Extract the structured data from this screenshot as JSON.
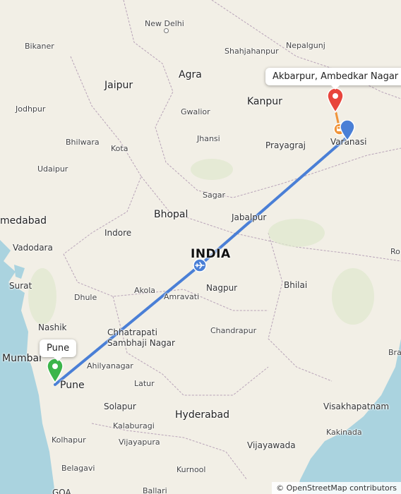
{
  "map": {
    "country_label": "INDIA",
    "cities": [
      {
        "id": "new-delhi",
        "label": "New Delhi"
      },
      {
        "id": "bikaner",
        "label": "Bikaner"
      },
      {
        "id": "shahjahanpur",
        "label": "Shahjahanpur"
      },
      {
        "id": "nepalgunj",
        "label": "Nepalgunj"
      },
      {
        "id": "agra",
        "label": "Agra"
      },
      {
        "id": "jaipur",
        "label": "Jaipur"
      },
      {
        "id": "kanpur",
        "label": "Kanpur"
      },
      {
        "id": "jodhpur",
        "label": "Jodhpur"
      },
      {
        "id": "gwalior",
        "label": "Gwalior"
      },
      {
        "id": "jhansi",
        "label": "Jhansi"
      },
      {
        "id": "bhilwara",
        "label": "Bhilwara"
      },
      {
        "id": "kota",
        "label": "Kota"
      },
      {
        "id": "prayagraj",
        "label": "Prayagraj"
      },
      {
        "id": "varanasi",
        "label": "Varanasi"
      },
      {
        "id": "udaipur",
        "label": "Udaipur"
      },
      {
        "id": "sagar",
        "label": "Sagar"
      },
      {
        "id": "bhopal",
        "label": "Bhopal"
      },
      {
        "id": "jabalpur",
        "label": "Jabalpur"
      },
      {
        "id": "ahmedabad",
        "label": "medabad"
      },
      {
        "id": "indore",
        "label": "Indore"
      },
      {
        "id": "vadodara",
        "label": "Vadodara"
      },
      {
        "id": "surat",
        "label": "Surat"
      },
      {
        "id": "nagpur",
        "label": "Nagpur"
      },
      {
        "id": "bhilai",
        "label": "Bhilai"
      },
      {
        "id": "dhule",
        "label": "Dhule"
      },
      {
        "id": "amravati",
        "label": "Amravati"
      },
      {
        "id": "akola",
        "label": "Akola"
      },
      {
        "id": "nashik",
        "label": "Nashik"
      },
      {
        "id": "chhatrapati",
        "label": "Chhatrapati\nSambhaji Nagar"
      },
      {
        "id": "chandrapur",
        "label": "Chandrapur"
      },
      {
        "id": "mumbai",
        "label": "Mumbai"
      },
      {
        "id": "ahilyanagar",
        "label": "Ahilyanagar"
      },
      {
        "id": "pune",
        "label": "Pune"
      },
      {
        "id": "latur",
        "label": "Latur"
      },
      {
        "id": "solapur",
        "label": "Solapur"
      },
      {
        "id": "hyderabad",
        "label": "Hyderabad"
      },
      {
        "id": "visakhapatnam",
        "label": "Visakhapatnam"
      },
      {
        "id": "kalaburagi",
        "label": "Kalaburagi"
      },
      {
        "id": "kolhapur",
        "label": "Kolhapur"
      },
      {
        "id": "vijayapura",
        "label": "Vijayapura"
      },
      {
        "id": "kakinada",
        "label": "Kakinada"
      },
      {
        "id": "vijayawada",
        "label": "Vijayawada"
      },
      {
        "id": "belagavi",
        "label": "Belagavi"
      },
      {
        "id": "kurnool",
        "label": "Kurnool"
      },
      {
        "id": "goa",
        "label": "GOA"
      },
      {
        "id": "ballari",
        "label": "Ballari"
      },
      {
        "id": "brah",
        "label": "Brah"
      },
      {
        "id": "ro",
        "label": "Ro"
      }
    ],
    "origin_label": "Pune",
    "destination_label": "Akbarpur, Ambedkar Nagar",
    "attribution": "© OpenStreetMap contributors",
    "route_color": "#4a7fd6",
    "origin_pin_color": "#3bb54a",
    "destination_pin_color": "#e8453c",
    "water_color": "#aad3df",
    "land_color": "#f2efe6",
    "icons": [
      "plane-icon",
      "bus-icon",
      "origin-pin-icon",
      "destination-pin-icon"
    ]
  }
}
